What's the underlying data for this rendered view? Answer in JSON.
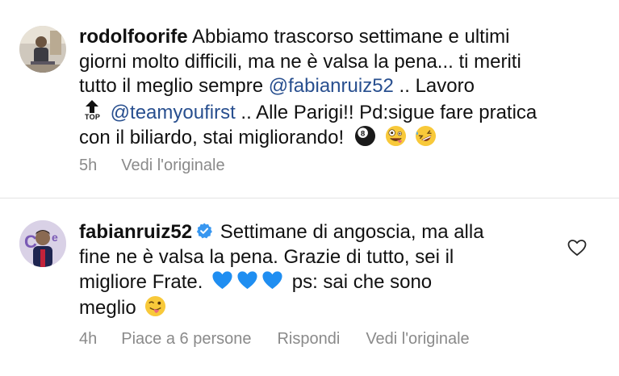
{
  "comments": [
    {
      "username": "rodolfoorife",
      "text_line1": "Abbiamo trascorso settimane e ultimi",
      "text_line2": "giorni molto difficili, ma ne è valsa la pena... ti meriti",
      "text_line3_pre": "tutto il meglio sempre ",
      "mention1": "@fabianruiz52",
      "text_line3_post": " .. Lavoro",
      "top_icon_label": "TOP",
      "mention2": "@teamyoufirst",
      "text_line4_post": " .. Alle Parigi!! Pd:sigue fare pratica",
      "text_line5": "con il biliardo, stai migliorando!",
      "emojis": [
        "eight-ball",
        "zany-face",
        "rolling-on-floor-laughing"
      ],
      "time": "5h",
      "actions": [
        "Vedi l'originale"
      ]
    },
    {
      "username": "fabianruiz52",
      "verified": true,
      "text_line1": "Settimane di angoscia, ma alla",
      "text_line2": "fine ne è valsa la pena. Grazie di tutto, sei il",
      "text_line3_pre": "migliore Frate.",
      "text_line3_post": "ps: sai che sono",
      "text_line4": "meglio",
      "hearts": [
        "blue-heart",
        "blue-heart",
        "blue-heart"
      ],
      "emoji_end": "winking-tongue-face",
      "time": "4h",
      "likes": "Piace a 6 persone",
      "reply": "Rispondi",
      "see_original": "Vedi l'originale"
    }
  ],
  "colors": {
    "text": "#111111",
    "mention": "#284f8f",
    "meta": "#8a8a8a",
    "verified": "#3897f0",
    "blue_heart": "#1f8ef1"
  }
}
